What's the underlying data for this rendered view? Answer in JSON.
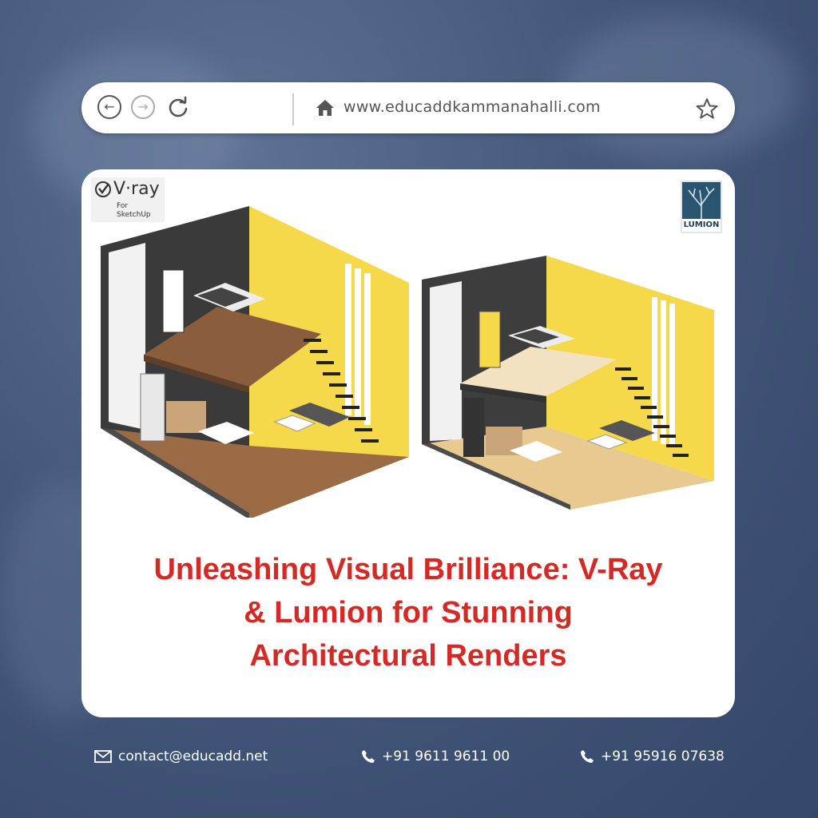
{
  "browser": {
    "url": "www.educaddkammanahalli.com"
  },
  "logos": {
    "vray_text": "V·ray",
    "vray_sub": "For SketchUp",
    "lumion_text": "LUMION"
  },
  "headline": {
    "line1": "Unleashing Visual Brilliance: V-Ray",
    "line2": "& Lumion for Stunning",
    "line3": "Architectural Renders"
  },
  "footer": {
    "email": "contact@educadd.net",
    "phone1": "+91 9611 9611 00",
    "phone2": "+91 95916 07638"
  },
  "colors": {
    "headline": "#d42a26",
    "background": "#44587a",
    "wall_yellow": "#f5d94a"
  }
}
